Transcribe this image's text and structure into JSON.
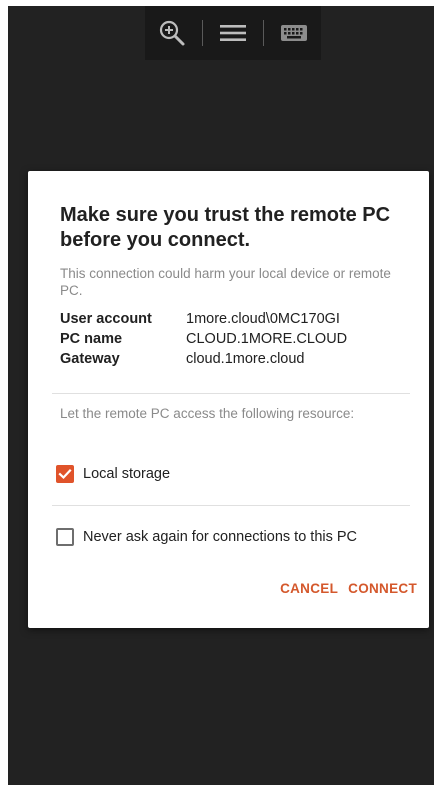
{
  "dialog": {
    "title": "Make sure you trust the remote PC before you connect.",
    "warning": "This connection could harm your local device or remote PC.",
    "info": [
      {
        "label": "User account",
        "value": "1more.cloud\\0MC170GI"
      },
      {
        "label": "PC name",
        "value": "CLOUD.1MORE.CLOUD"
      },
      {
        "label": "Gateway",
        "value": "cloud.1more.cloud"
      }
    ],
    "resource_text": "Let the remote PC access the following resource:",
    "local_storage": {
      "label": "Local storage",
      "checked": true
    },
    "never_ask": {
      "label": "Never ask again for connections to this PC",
      "checked": false
    },
    "cancel_label": "CANCEL",
    "connect_label": "CONNECT"
  },
  "toolbar": {
    "icons": [
      "zoom-in-icon",
      "menu-icon",
      "keyboard-icon"
    ]
  },
  "colors": {
    "accent": "#e0532a",
    "background": "#222222",
    "toolbar": "#191919"
  }
}
